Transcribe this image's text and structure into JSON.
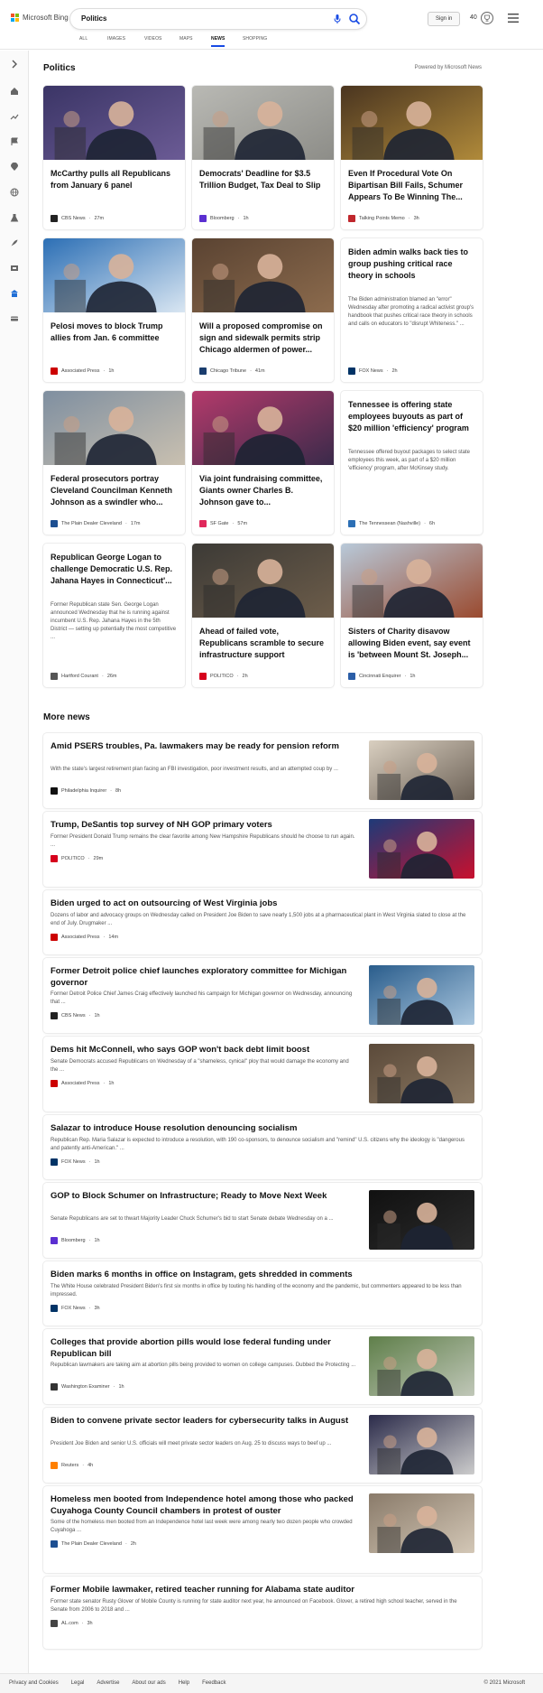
{
  "header": {
    "brand": "Microsoft Bing",
    "query": "Politics",
    "signin_label": "Sign in",
    "points": "40",
    "tabs": [
      {
        "label": "ALL",
        "active": false
      },
      {
        "label": "IMAGES",
        "active": false
      },
      {
        "label": "VIDEOS",
        "active": false
      },
      {
        "label": "MAPS",
        "active": false
      },
      {
        "label": "NEWS",
        "active": true
      },
      {
        "label": "SHOPPING",
        "active": false
      }
    ]
  },
  "rail_icons": [
    "chevron-right-icon",
    "home-icon",
    "trending-icon",
    "flag-icon",
    "location-pin-icon",
    "globe-icon",
    "lab-flask-icon",
    "rocket-icon",
    "film-icon",
    "building-icon",
    "card-icon"
  ],
  "section": {
    "title": "Politics",
    "powered_by": "Powered by Microsoft News"
  },
  "cards": [
    {
      "title": "McCarthy pulls all Republicans from January 6 panel",
      "source": "CBS News",
      "age": "27m",
      "badge_color": "#222222",
      "image": "mccarthy",
      "snippet": ""
    },
    {
      "title": "Democrats' Deadline for $3.5 Trillion Budget, Tax Deal to Slip",
      "source": "Bloomberg",
      "age": "1h",
      "badge_color": "#5b2fd1",
      "image": "capitol-walk",
      "snippet": ""
    },
    {
      "title": "Even If Procedural Vote On Bipartisan Bill Fails, Schumer Appears To Be Winning The...",
      "source": "Talking Points Memo",
      "age": "3h",
      "badge_color": "#c0272d",
      "image": "schumer",
      "snippet": ""
    },
    {
      "title": "Pelosi moves to block Trump allies from Jan. 6 committee",
      "source": "Associated Press",
      "age": "1h",
      "badge_color": "#cc0000",
      "image": "pelosi",
      "snippet": ""
    },
    {
      "title": "Will a proposed compromise on sign and sidewalk permits strip Chicago aldermen of power...",
      "source": "Chicago Tribune",
      "age": "41m",
      "badge_color": "#1a3d6e",
      "image": "chicago",
      "snippet": ""
    },
    {
      "title": "Biden admin walks back ties to group pushing critical race theory in schools",
      "source": "FOX News",
      "age": "2h",
      "badge_color": "#003366",
      "image": "",
      "snippet": "The Biden administration blamed an \"error\" Wednesday after promoting a radical activist group's handbook that pushes critical race theory in schools and calls on educators to \"disrupt Whiteness.\" ..."
    },
    {
      "title": "Federal prosecutors portray Cleveland Councilman Kenneth Johnson as a swindler who...",
      "source": "The Plain Dealer Cleveland",
      "age": "17m",
      "badge_color": "#1d4f91",
      "image": "cleveland",
      "snippet": ""
    },
    {
      "title": "Via joint fundraising committee, Giants owner Charles B. Johnson gave to...",
      "source": "SF Gate",
      "age": "57m",
      "badge_color": "#e0285b",
      "image": "giants",
      "snippet": ""
    },
    {
      "title": "Tennessee is offering state employees buyouts as part of $20 million 'efficiency' program",
      "source": "The Tennessean (Nashville)",
      "age": "6h",
      "badge_color": "#2c6fb5",
      "image": "",
      "snippet": "Tennessee offered buyout packages to select state employees this week, as part of a $20 million 'efficiency' program, after McKinsey study."
    },
    {
      "title": "Republican George Logan to challenge Democratic U.S. Rep. Jahana Hayes in Connecticut'...",
      "source": "Hartford Courant",
      "age": "26m",
      "badge_color": "#555555",
      "image": "",
      "snippet": "Former Republican state Sen. George Logan announced Wednesday that he is running against incumbent U.S. Rep. Jahana Hayes in the 5th District — setting up potentially the most competitive ..."
    },
    {
      "title": "Ahead of failed vote, Republicans scramble to secure infrastructure support",
      "source": "POLITICO",
      "age": "2h",
      "badge_color": "#d6001c",
      "image": "politico",
      "snippet": ""
    },
    {
      "title": "Sisters of Charity disavow allowing Biden event, say event is 'between Mount St. Joseph...",
      "source": "Cincinnati Enquirer",
      "age": "1h",
      "badge_color": "#2b5ea7",
      "image": "college",
      "snippet": ""
    }
  ],
  "more_news": {
    "title": "More news",
    "items": [
      {
        "title": "Amid PSERS troubles, Pa. lawmakers may be ready for pension reform",
        "snippet": "With the state's largest retirement plan facing an FBI investigation, poor investment results, and an attempted coup by ...",
        "source": "Philadelphia Inquirer",
        "age": "8h",
        "badge_color": "#111111",
        "thumb": "pension"
      },
      {
        "title": "Trump, DeSantis top survey of NH GOP primary voters",
        "snippet": "Former President Donald Trump remains the clear favorite among New Hampshire Republicans should he choose to run again. ...",
        "source": "POLITICO",
        "age": "29m",
        "badge_color": "#d6001c",
        "thumb": "trump"
      },
      {
        "title": "Biden urged to act on outsourcing of West Virginia jobs",
        "snippet": "Dozens of labor and advocacy groups on Wednesday called on President Joe Biden to save nearly 1,500 jobs at a pharmaceutical plant in West Virginia slated to close at the end of July. Drugmaker ...",
        "source": "Associated Press",
        "age": "14m",
        "badge_color": "#cc0000",
        "thumb": ""
      },
      {
        "title": "Former Detroit police chief launches exploratory committee for Michigan governor",
        "snippet": "Former Detroit Police Chief James Craig effectively launched his campaign for Michigan governor on Wednesday, announcing that ...",
        "source": "CBS News",
        "age": "1h",
        "badge_color": "#222222",
        "thumb": "craig"
      },
      {
        "title": "Dems hit McConnell, who says GOP won't back debt limit boost",
        "snippet": "Senate Democrats accused Republicans on Wednesday of a \"shameless, cynical\" ploy that would damage the economy and the ...",
        "source": "Associated Press",
        "age": "1h",
        "badge_color": "#cc0000",
        "thumb": "mcconnell"
      },
      {
        "title": "Salazar to introduce House resolution denouncing socialism",
        "snippet": "Republican Rep. Maria Salazar is expected to introduce a resolution, with 190 co-sponsors, to denounce socialism and \"remind\" U.S. citizens why the ideology is \"dangerous and patently anti-American.\" ...",
        "source": "FOX News",
        "age": "1h",
        "badge_color": "#003366",
        "thumb": ""
      },
      {
        "title": "GOP to Block Schumer on Infrastructure; Ready to Move Next Week",
        "snippet": "Senate Republicans are set to thwart Majority Leader Chuck Schumer's bid to start Senate debate Wednesday on a ...",
        "source": "Bloomberg",
        "age": "1h",
        "badge_color": "#5b2fd1",
        "thumb": "dark"
      },
      {
        "title": "Biden marks 6 months in office on Instagram, gets shredded in comments",
        "snippet": "The White House celebrated President Biden's first six months in office by touting his handling of the economy and the pandemic, but commenters appeared to be less than impressed.",
        "source": "FOX News",
        "age": "3h",
        "badge_color": "#003366",
        "thumb": ""
      },
      {
        "title": "Colleges that provide abortion pills would lose federal funding under Republican bill",
        "snippet": "Republican lawmakers are taking aim at abortion pills being provided to women on college campuses. Dubbed the Protecting ...",
        "source": "Washington Examiner",
        "age": "1h",
        "badge_color": "#333333",
        "thumb": "outdoor"
      },
      {
        "title": "Biden to convene private sector leaders for cybersecurity talks in August",
        "snippet": "President Joe Biden and senior U.S. officials will meet private sector leaders on Aug. 25 to discuss ways to beef up ...",
        "source": "Reuters",
        "age": "4h",
        "badge_color": "#ff8000",
        "thumb": "biden"
      },
      {
        "title": "Homeless men booted from Independence hotel among those who packed Cuyahoga County Council chambers in protest of ouster",
        "snippet": "Some of the homeless men booted from an Independence hotel last week were among nearly two dozen people who crowded Cuyahoga ...",
        "source": "The Plain Dealer Cleveland",
        "age": "2h",
        "badge_color": "#1d4f91",
        "thumb": "council"
      },
      {
        "title": "Former Mobile lawmaker, retired teacher running for Alabama state auditor",
        "snippet": "Former state senator Rusty Glover of Mobile County is running for state auditor next year, he announced on Facebook. Glover, a retired high school teacher, served in the Senate from 2006 to 2018 and ...",
        "source": "AL.com",
        "age": "3h",
        "badge_color": "#444444",
        "thumb": ""
      }
    ]
  },
  "footer": {
    "links": [
      "Privacy and Cookies",
      "Legal",
      "Advertise",
      "About our ads",
      "Help",
      "Feedback"
    ],
    "copyright": "© 2021 Microsoft"
  }
}
